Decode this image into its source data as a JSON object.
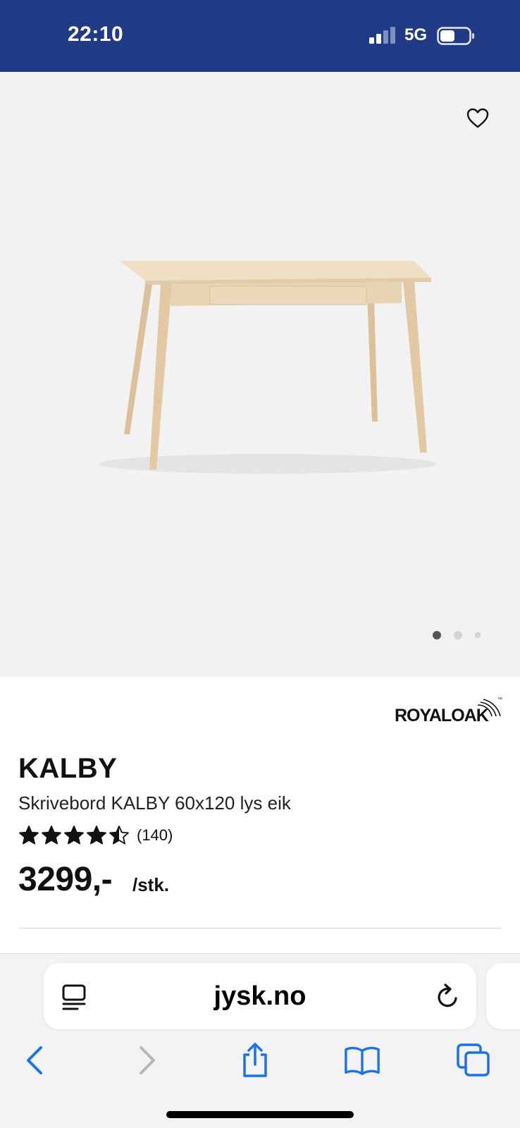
{
  "status_bar": {
    "time": "22:10",
    "network": "5G",
    "signal_bars_active": 2,
    "signal_bars_total": 4,
    "background_color": "#213a86"
  },
  "gallery": {
    "favorite_icon": "heart-outline-icon",
    "image_description_icon": "desk-product-image",
    "page_count": 3,
    "active_page": 1
  },
  "product": {
    "brand_logo_text": "ROYALOAK",
    "brand_logo_tm": "™",
    "name": "KALBY",
    "description": "Skrivebord KALBY 60x120 lys eik",
    "rating": 4.5,
    "rating_max": 5,
    "rating_count": "(140)",
    "price": "3299,-",
    "unit": "/stk."
  },
  "browser": {
    "url": "jysk.no",
    "reader_icon": "reader-mode-icon",
    "reload_icon": "reload-icon",
    "toolbar": [
      {
        "name": "back-icon",
        "enabled": true
      },
      {
        "name": "forward-icon",
        "enabled": false
      },
      {
        "name": "share-icon",
        "enabled": true
      },
      {
        "name": "bookmarks-icon",
        "enabled": true
      },
      {
        "name": "tabs-icon",
        "enabled": true
      }
    ],
    "accent_color": "#1a73e8"
  }
}
